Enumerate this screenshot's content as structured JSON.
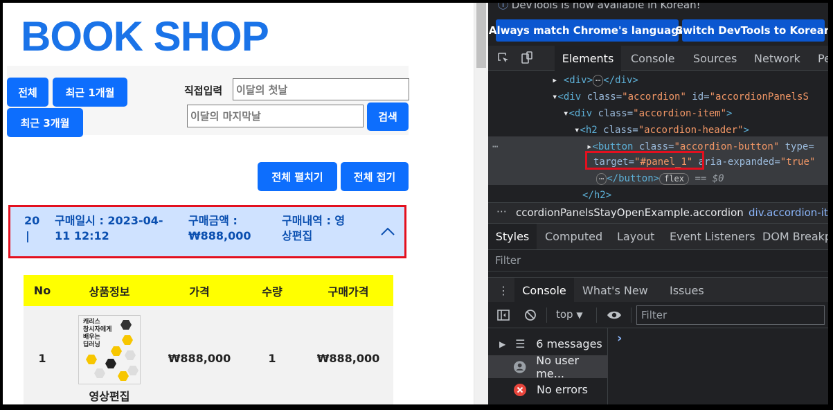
{
  "shop": {
    "logo": "BOOK SHOP",
    "filters": {
      "all": "전체",
      "last_1m": "최근 1개월",
      "last_3m": "최근 3개월",
      "direct_label": "직접입력",
      "start_placeholder": "이달의 첫날",
      "end_placeholder": "이달의 마지막날",
      "search": "검색"
    },
    "expand_all": "전체 펼치기",
    "collapse_all": "전체 접기",
    "accordion": {
      "id_line1": "20",
      "id_line2": "|",
      "date_line1": "구매일시 : 2023-04-",
      "date_line2": "11 12:12",
      "amount_line1": "구매금액 :",
      "amount_line2": "₩888,000",
      "desc_line1": "구매내역 : 영",
      "desc_line2": "상편집"
    },
    "table": {
      "headers": [
        "No",
        "상품정보",
        "가격",
        "수량",
        "구매가격"
      ],
      "rows": [
        {
          "no": "1",
          "cover_text": "캐리스\n창시자에게\n배우는\n딥러닝",
          "name": "영상편집",
          "price": "₩888,000",
          "qty": "1",
          "total": "₩888,000"
        }
      ]
    }
  },
  "devtools": {
    "notice": "DevTools is now available in Korean!",
    "match_lang_btn": "Always match Chrome's language",
    "switch_btn": "Switch DevTools to Korean",
    "tabs": [
      "Elements",
      "Console",
      "Sources",
      "Network",
      "Pe"
    ],
    "code": {
      "l1": "<div>",
      "l1b": "</div>",
      "l2_tag": "<div ",
      "l2_a1": "class=",
      "l2_v1": "\"accordion\"",
      "l2_a2": " id=",
      "l2_v2": "\"accordionPanelsS",
      "l3_tag": "<div ",
      "l3_a1": "class=",
      "l3_v1": "\"accordion-item\"",
      "l3_end": ">",
      "l4_tag": "<h2 ",
      "l4_a1": "class=",
      "l4_v1": "\"accordion-header\"",
      "l4_end": ">",
      "l5_tag": "<button ",
      "l5_a1": "class=",
      "l5_v1": "\"accordion-button\"",
      "l5_a2": " type=",
      "l6_a1": "target=",
      "l6_v1": "\"#panel_1\"",
      "l6_a2": " aria-expanded=",
      "l6_v2": "\"true\"",
      "l7_tag": "</button>",
      "l7_pill": "flex",
      "l7_eq": "== $0",
      "l8_tag": "</h2>"
    },
    "crumbs": [
      "ccordionPanelsStayOpenExample.accordion",
      "div.accordion-ite"
    ],
    "subtabs": [
      "Styles",
      "Computed",
      "Layout",
      "Event Listeners",
      "DOM Breakp"
    ],
    "filter_placeholder": "Filter",
    "drawer_tabs": [
      "Console",
      "What's New",
      "Issues"
    ],
    "console_context": "top",
    "console_filter_placeholder": "Filter",
    "sidebar": [
      "6 messages",
      "No user me...",
      "No errors"
    ],
    "prompt": "›"
  }
}
